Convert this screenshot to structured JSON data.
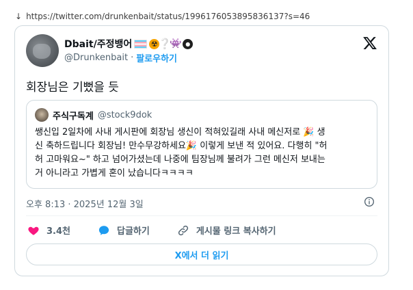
{
  "browser": {
    "download_glyph": "↓",
    "url": "https://twitter.com/drunkenbait/status/1996176053895836137?s=46"
  },
  "author": {
    "display_name": "Dbait/주정뱅어",
    "handle": "@Drunkenbait",
    "separator": "·",
    "follow_label": "팔로우하기",
    "badges": [
      "transgender-flag-icon",
      "radioactive-icon",
      "question-mark-icon",
      "purple-invader-icon",
      "bomb-icon"
    ]
  },
  "tweet": {
    "text": "회장님은 기뻤을 듯",
    "timestamp": "오후 8:13 · 2025년 12월 3일"
  },
  "quote": {
    "display_name": "주식구독계",
    "handle": "@stock9dok",
    "lines": [
      "쌩신입 2일차에 사내 게시판에 회장님 생신이 적혀있길래 사내 메신저로 🎉 생",
      "신 축하드립니다 회장님! 만수무강하세요🎉 이렇게 보낸 적 있어요. 다행히 \"허",
      "허 고마워요~\" 하고 넘어가셨는데 나중에 팀장님께 불려가 그런 메신저 보내는",
      "거 아니라고 가볍게 혼이 났습니다ㅋㅋㅋㅋ"
    ]
  },
  "actions": {
    "like_count": "3.4천",
    "reply_label": "답글하기",
    "copy_link_label": "게시물 링크 복사하기"
  },
  "read_more_label": "X에서 더 읽기",
  "colors": {
    "accent": "#1d9bf0",
    "like": "#f91880",
    "border": "#cfd9de",
    "secondary_text": "#536471"
  }
}
